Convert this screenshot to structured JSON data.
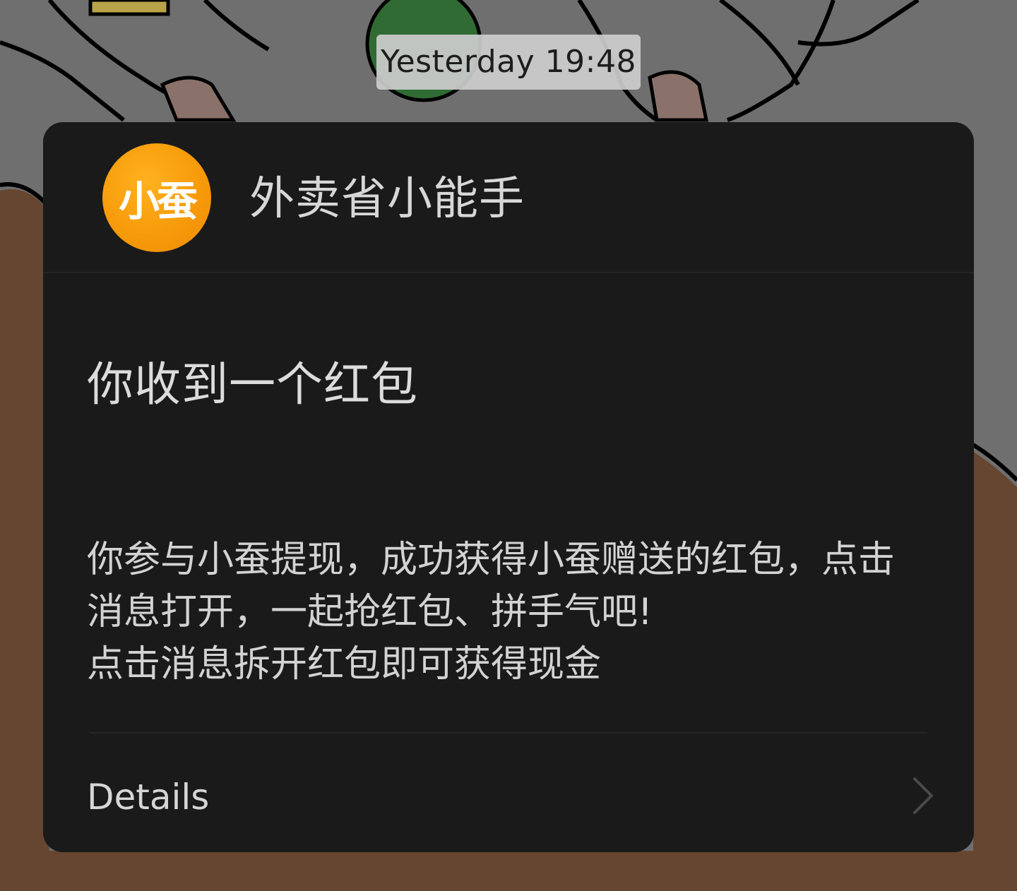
{
  "timestamp": "Yesterday 19:48",
  "card": {
    "avatar_text": "小蚕",
    "app_name": "外卖省小能手",
    "title": "你收到一个红包",
    "body_lines": [
      "你参与小蚕提现，成功获得小蚕赠送的红包，点击",
      "消息打开，一起抢红包、拼手气吧!",
      "点击消息拆开红包即可获得现金"
    ],
    "details_label": "Details",
    "details_icon": "chevron-right-icon"
  },
  "colors": {
    "card_bg": "#1a1a1a",
    "avatar_orange": "#f79b0a",
    "wallpaper_gray": "#6f6f6f",
    "wallpaper_brown": "#664630"
  }
}
